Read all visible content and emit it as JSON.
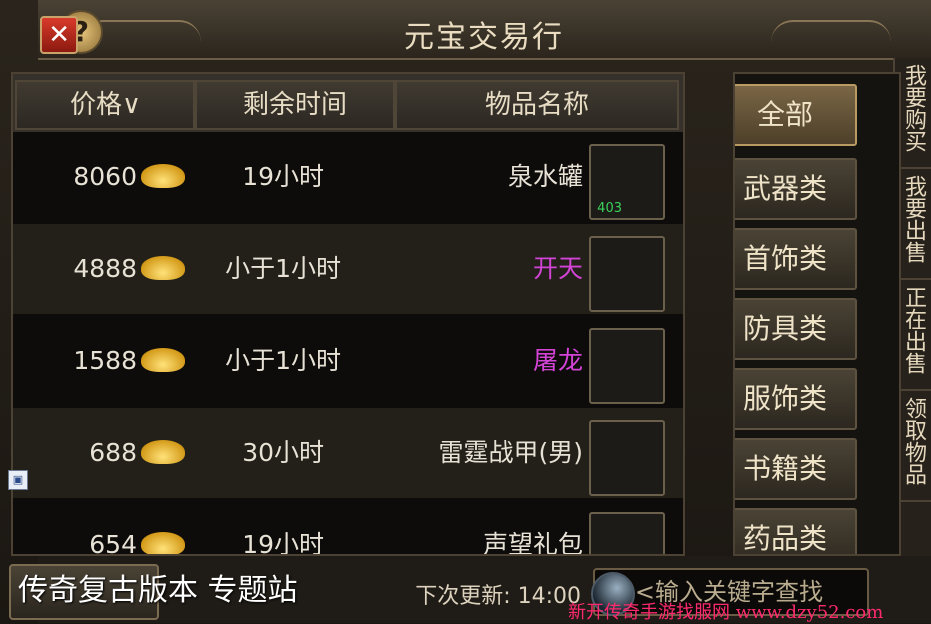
{
  "window": {
    "title": "元宝交易行"
  },
  "title_icons": {
    "help": "?",
    "close": "✕"
  },
  "table": {
    "headers": {
      "name": "物品名称",
      "time": "剩余时间",
      "price": "价格∨"
    },
    "rows": [
      {
        "item_icon": "jar-icon",
        "slot_count": "403",
        "name": "泉水罐",
        "name_color": "#e8e2d6",
        "time": "19小时",
        "price": "8060"
      },
      {
        "item_icon": "sword-icon",
        "slot_count": "",
        "name": "开天",
        "name_color": "#d243d6",
        "time": "小于1小时",
        "price": "4888"
      },
      {
        "item_icon": "blade-icon",
        "slot_count": "",
        "name": "屠龙",
        "name_color": "#d243d6",
        "time": "小于1小时",
        "price": "1588"
      },
      {
        "item_icon": "armor-icon",
        "slot_count": "",
        "name": "雷霆战甲(男)",
        "name_color": "#e8e2d6",
        "time": "30小时",
        "price": "688"
      },
      {
        "item_icon": "bag-icon",
        "slot_count": "",
        "name": "声望礼包",
        "name_color": "#e8e2d6",
        "time": "19小时",
        "price": "654"
      }
    ]
  },
  "categories": [
    "全部",
    "武器类",
    "首饰类",
    "防具类",
    "服饰类",
    "书籍类",
    "药品类"
  ],
  "side_tabs": [
    "我要购买",
    "我要出售",
    "正在出售",
    "领取物品"
  ],
  "bottom": {
    "search_placeholder": "<输入关键字查找",
    "next_update": "下次更新: 14:00"
  },
  "overlay_text": "传奇复古版本 专题站",
  "watermark": "新开传奇手游找服网 www.dzy52.com",
  "colors": {
    "accent": "#b89a62",
    "purple": "#d243d6",
    "gold": "#e0b033",
    "close": "#c0281a"
  }
}
